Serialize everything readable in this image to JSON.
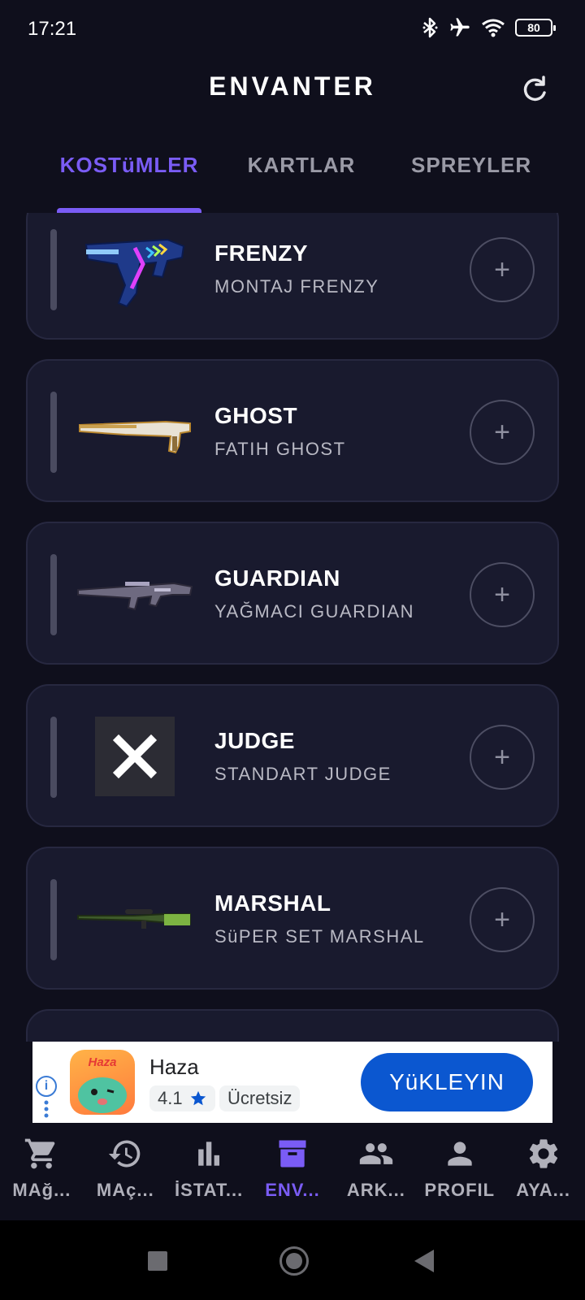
{
  "status_bar": {
    "time": "17:21",
    "battery": "80",
    "icons": [
      "bluetooth-icon",
      "airplane-icon",
      "wifi-icon",
      "battery-icon"
    ]
  },
  "header": {
    "title": "ENVANTER",
    "refresh_icon": "refresh-icon"
  },
  "tabs": [
    {
      "label": "KOSTüMLER",
      "active": true
    },
    {
      "label": "KARTLAR",
      "active": false
    },
    {
      "label": "SPREYLER",
      "active": false
    }
  ],
  "items": [
    {
      "weapon": "FRENZY",
      "skin": "MONTAJ FRENZY",
      "image": "frenzy-gun"
    },
    {
      "weapon": "GHOST",
      "skin": "FATIH GHOST",
      "image": "ghost-gun"
    },
    {
      "weapon": "GUARDIAN",
      "skin": "YAĞMACI GUARDIAN",
      "image": "guardian-gun"
    },
    {
      "weapon": "JUDGE",
      "skin": "STANDART JUDGE",
      "image": "missing-image-x"
    },
    {
      "weapon": "MARSHAL",
      "skin": "SüPER SET MARSHAL",
      "image": "marshal-gun"
    }
  ],
  "ad": {
    "app_name": "Haza",
    "app_icon_text": "Haza",
    "rating": "4.1",
    "price": "Ücretsiz",
    "cta": "YüKLEYIN"
  },
  "bottom_nav": [
    {
      "label": "MAğ...",
      "icon": "cart-icon",
      "active": false
    },
    {
      "label": "MAç...",
      "icon": "history-icon",
      "active": false
    },
    {
      "label": "İSTAT...",
      "icon": "stats-icon",
      "active": false
    },
    {
      "label": "ENV...",
      "icon": "archive-icon",
      "active": true
    },
    {
      "label": "ARK...",
      "icon": "friends-icon",
      "active": false
    },
    {
      "label": "PROFIL",
      "icon": "person-icon",
      "active": false
    },
    {
      "label": "AYA...",
      "icon": "settings-icon",
      "active": false
    }
  ],
  "colors": {
    "background": "#0f0f1c",
    "card": "#191a2e",
    "accent": "#7a5cf5",
    "ad_button": "#0b57d0"
  }
}
